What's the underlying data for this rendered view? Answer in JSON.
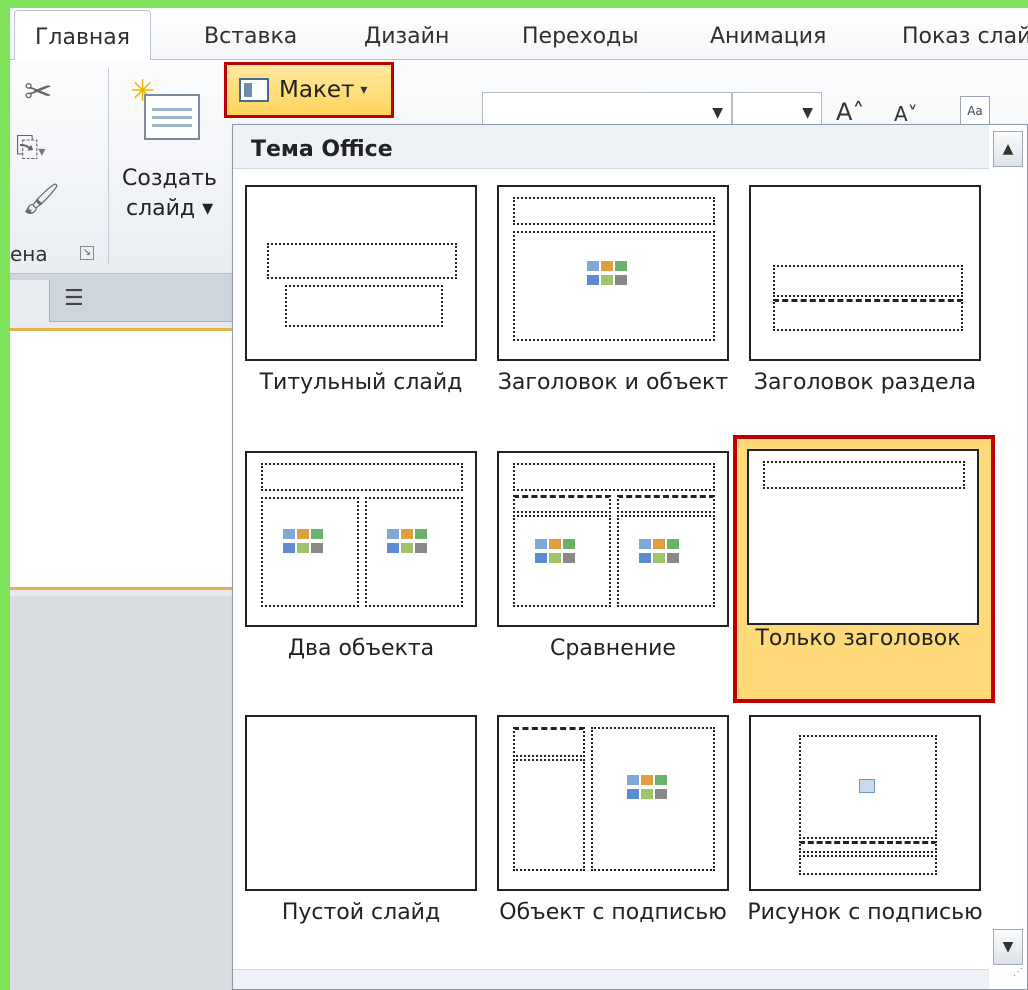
{
  "tabs": [
    {
      "label": "Главная",
      "active": true
    },
    {
      "label": "Вставка"
    },
    {
      "label": "Дизайн"
    },
    {
      "label": "Переходы"
    },
    {
      "label": "Анимация"
    },
    {
      "label": "Показ слай"
    }
  ],
  "ribbon": {
    "clipboard_group_label": "ена",
    "new_slide_line1": "Создать",
    "new_slide_line2": "слайд ▾",
    "layout_button_label": "Макет",
    "layout_button_arrow": "▾",
    "font_size_up": "A˄",
    "font_size_down": "A˅"
  },
  "gallery": {
    "header": "Тема Office",
    "layouts": [
      {
        "label": "Титульный слайд",
        "selected": false
      },
      {
        "label": "Заголовок и объект",
        "selected": false
      },
      {
        "label": "Заголовок раздела",
        "selected": false
      },
      {
        "label": "Два объекта",
        "selected": false
      },
      {
        "label": "Сравнение",
        "selected": false
      },
      {
        "label": "Только заголовок",
        "selected": true
      },
      {
        "label": "Пустой слайд",
        "selected": false
      },
      {
        "label": "Объект с подписью",
        "selected": false
      },
      {
        "label": "Рисунок с подписью",
        "selected": false
      }
    ]
  },
  "colors": {
    "accent_highlight": "#ffd97a",
    "selection_border": "#c00000",
    "frame_background": "#7ee35a"
  },
  "icons": [
    "cut-icon",
    "copy-icon",
    "format-painter-icon",
    "new-slide-icon",
    "layout-icon",
    "scroll-up-icon",
    "scroll-down-icon",
    "outline-icon"
  ]
}
